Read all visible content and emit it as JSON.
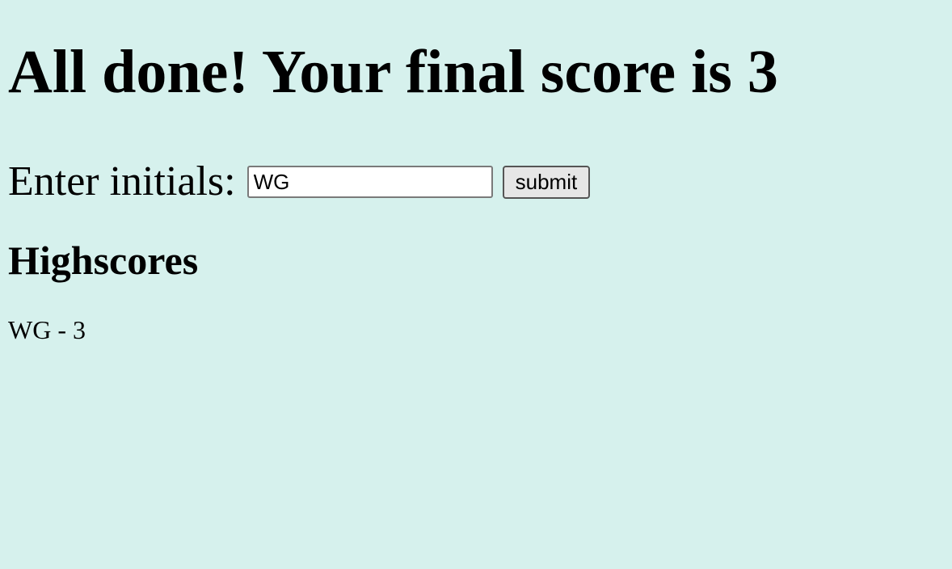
{
  "page": {
    "background_color": "#d6f1ed"
  },
  "result": {
    "title": "All done! Your final score is 3"
  },
  "initials_form": {
    "label": "Enter initials:",
    "input_value": "WG",
    "submit_label": "submit"
  },
  "highscores": {
    "heading": "Highscores",
    "entries": [
      "WG - 3"
    ]
  }
}
